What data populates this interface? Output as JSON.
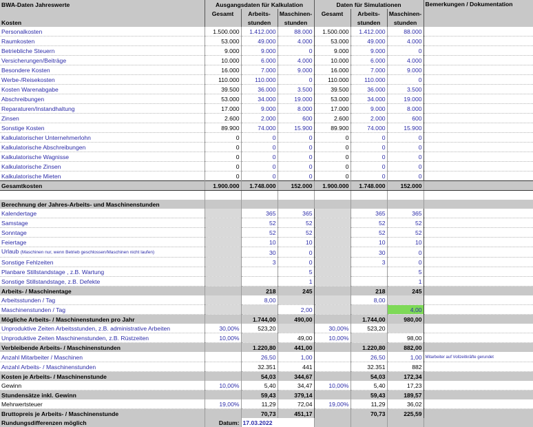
{
  "header": {
    "title": "BWA-Daten Jahreswerte",
    "subtitle": "Kosten",
    "group_kalk": "Ausgangsdaten für Kalkulation",
    "group_sim": "Daten für Simulationen",
    "remarks": "Bemerkungen / Dokumentation",
    "col_gesamt": "Gesamt",
    "col_arbeit1": "Arbeits-",
    "col_arbeit2": "stunden",
    "col_masch1": "Maschinen-",
    "col_masch2": "stunden"
  },
  "costs": [
    {
      "label": "Personalkosten",
      "g1": "1.500.000",
      "a1": "1.412.000",
      "m1": "88.000",
      "g2": "1.500.000",
      "a2": "1.412.000",
      "m2": "88.000"
    },
    {
      "label": "Raumkosten",
      "g1": "53.000",
      "a1": "49.000",
      "m1": "4.000",
      "g2": "53.000",
      "a2": "49.000",
      "m2": "4.000"
    },
    {
      "label": "Betriebliche Steuern",
      "g1": "9.000",
      "a1": "9.000",
      "m1": "0",
      "g2": "9.000",
      "a2": "9.000",
      "m2": "0"
    },
    {
      "label": "Versicherungen/Beiträge",
      "g1": "10.000",
      "a1": "6.000",
      "m1": "4.000",
      "g2": "10.000",
      "a2": "6.000",
      "m2": "4.000"
    },
    {
      "label": "Besondere Kosten",
      "g1": "16.000",
      "a1": "7.000",
      "m1": "9.000",
      "g2": "16.000",
      "a2": "7.000",
      "m2": "9.000"
    },
    {
      "label": "Werbe-/Reisekosten",
      "g1": "110.000",
      "a1": "110.000",
      "m1": "0",
      "g2": "110.000",
      "a2": "110.000",
      "m2": "0"
    },
    {
      "label": "Kosten Warenabgabe",
      "g1": "39.500",
      "a1": "36.000",
      "m1": "3.500",
      "g2": "39.500",
      "a2": "36.000",
      "m2": "3.500"
    },
    {
      "label": "Abschreibungen",
      "g1": "53.000",
      "a1": "34.000",
      "m1": "19.000",
      "g2": "53.000",
      "a2": "34.000",
      "m2": "19.000"
    },
    {
      "label": "Reparaturen/Instandhaltung",
      "g1": "17.000",
      "a1": "9.000",
      "m1": "8.000",
      "g2": "17.000",
      "a2": "9.000",
      "m2": "8.000"
    },
    {
      "label": "Zinsen",
      "g1": "2.600",
      "a1": "2.000",
      "m1": "600",
      "g2": "2.600",
      "a2": "2.000",
      "m2": "600"
    },
    {
      "label": "Sonstige Kosten",
      "g1": "89.900",
      "a1": "74.000",
      "m1": "15.900",
      "g2": "89.900",
      "a2": "74.000",
      "m2": "15.900"
    },
    {
      "label": "Kalkulatorischer Unternehmerlohn",
      "g1": "0",
      "a1": "0",
      "m1": "0",
      "g2": "0",
      "a2": "0",
      "m2": "0"
    },
    {
      "label": "Kalkulatorische Abschreibungen",
      "g1": "0",
      "a1": "0",
      "m1": "0",
      "g2": "0",
      "a2": "0",
      "m2": "0"
    },
    {
      "label": "Kalkulatorische Wagnisse",
      "g1": "0",
      "a1": "0",
      "m1": "0",
      "g2": "0",
      "a2": "0",
      "m2": "0"
    },
    {
      "label": "Kalkulatorische Zinsen",
      "g1": "0",
      "a1": "0",
      "m1": "0",
      "g2": "0",
      "a2": "0",
      "m2": "0"
    },
    {
      "label": "Kalkulatorische Mieten",
      "g1": "0",
      "a1": "0",
      "m1": "0",
      "g2": "0",
      "a2": "0",
      "m2": "0"
    }
  ],
  "total_costs": {
    "label": "Gesamtkosten",
    "g1": "1.900.000",
    "a1": "1.748.000",
    "m1": "152.000",
    "g2": "1.900.000",
    "a2": "1.748.000",
    "m2": "152.000"
  },
  "calc_title": "Berechnung der Jahres-Arbeits- und Maschinenstunden",
  "days": [
    {
      "label": "Kalendertage",
      "a1": "365",
      "m1": "365",
      "a2": "365",
      "m2": "365"
    },
    {
      "label": "Samstage",
      "a1": "52",
      "m1": "52",
      "a2": "52",
      "m2": "52"
    },
    {
      "label": "Sonntage",
      "a1": "52",
      "m1": "52",
      "a2": "52",
      "m2": "52"
    },
    {
      "label": "Feiertage",
      "a1": "10",
      "m1": "10",
      "a2": "10",
      "m2": "10"
    },
    {
      "label": "Urlaub",
      "small": "(Maschinen nur, wenn Betrieb geschlossen/Maschinen nicht laufen)",
      "a1": "30",
      "m1": "0",
      "a2": "30",
      "m2": "0"
    },
    {
      "label": "Sonstige Fehlzeiten",
      "a1": "3",
      "m1": "0",
      "a2": "3",
      "m2": "0"
    },
    {
      "label": "Planbare Stillstandstage , z.B. Wartung",
      "a1": "",
      "m1": "5",
      "a2": "",
      "m2": "5"
    },
    {
      "label": "Sonstige Stillstandstage, z.B. Defekte",
      "a1": "",
      "m1": "1",
      "a2": "",
      "m2": "1"
    }
  ],
  "rows": {
    "arbeitstage": {
      "label": "Arbeits- / Maschinentage",
      "a1": "218",
      "m1": "245",
      "a2": "218",
      "m2": "245"
    },
    "stunden_tag": {
      "label": "Arbeitsstunden / Tag",
      "a1": "8,00",
      "a2": "8,00"
    },
    "masch_tag": {
      "label": "Maschinenstunden / Tag",
      "m1": "2,00",
      "m2": "4,00"
    },
    "moegliche": {
      "label": "Mögliche Arbeits- / Maschinenstunden pro Jahr",
      "a1": "1.744,00",
      "m1": "490,00",
      "a2": "1.744,00",
      "m2": "980,00"
    },
    "unprod_a": {
      "label": "Unproduktive Zeiten Arbeitsstunden, z.B. administrative Arbeiten",
      "g1": "30,00%",
      "a1": "523,20",
      "g2": "30,00%",
      "a2": "523,20"
    },
    "unprod_m": {
      "label": "Unproduktive Zeiten Maschinenstunden, z.B. Rüstzeiten",
      "g1": "10,00%",
      "m1": "49,00",
      "g2": "10,00%",
      "m2": "98,00"
    },
    "verbleibend": {
      "label": "Verbleibende Arbeits- / Maschinenstunden",
      "a1": "1.220,80",
      "m1": "441,00",
      "a2": "1.220,80",
      "m2": "882,00"
    },
    "mitarbeiter": {
      "label": "Anzahl Mitarbeiter / Maschinen",
      "a1": "26,50",
      "m1": "1,00",
      "a2": "26,50",
      "m2": "1,00",
      "note": "Mitarbeiter auf Vollzeitkräfte gerundet"
    },
    "anzahl_std": {
      "label": "Anzahl Arbeits- / Maschinenstunden",
      "a1": "32.351",
      "m1": "441",
      "a2": "32.351",
      "m2": "882"
    },
    "kosten_std": {
      "label": "Kosten je Arbeits- / Maschinenstunde",
      "a1": "54,03",
      "m1": "344,67",
      "a2": "54,03",
      "m2": "172,34"
    },
    "gewinn": {
      "label": "Gewinn",
      "g1": "10,00%",
      "a1": "5,40",
      "m1": "34,47",
      "g2": "10,00%",
      "a2": "5,40",
      "m2": "17,23"
    },
    "stundensatz": {
      "label": "Stundensätze inkl. Gewinn",
      "a1": "59,43",
      "m1": "379,14",
      "a2": "59,43",
      "m2": "189,57"
    },
    "mwst": {
      "label": "Mehrwertsteuer",
      "g1": "19,00%",
      "a1": "11,29",
      "m1": "72,04",
      "g2": "19,00%",
      "a2": "11,29",
      "m2": "36,02"
    },
    "brutto": {
      "label": "Bruttopreis je Arbeits- / Maschinenstunde",
      "a1": "70,73",
      "m1": "451,17",
      "a2": "70,73",
      "m2": "225,59"
    },
    "rundung": {
      "label": "Rundungsdifferenzen möglich",
      "date_label": "Datum:",
      "date": "17.03.2022"
    }
  },
  "colors": {
    "header_grey": "#c8c8c8",
    "input_blue": "#2b2ba8",
    "highlight_green": "#7ed957",
    "cell_grey": "#d9d9d9"
  }
}
